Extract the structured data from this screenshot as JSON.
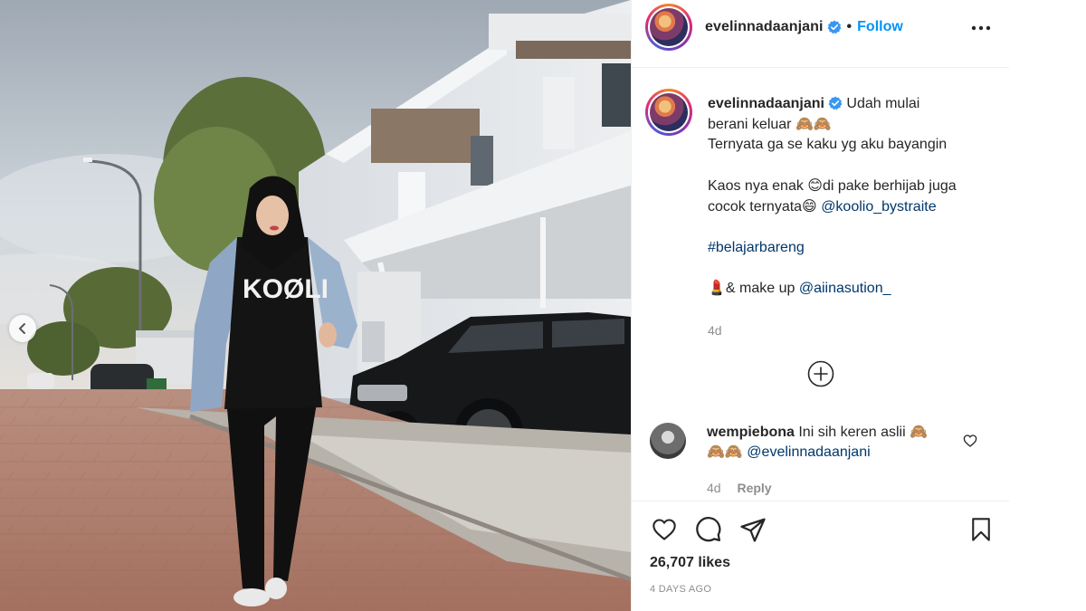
{
  "post": {
    "username": "evelinnadaanjani",
    "follow_label": "Follow",
    "separator": "•",
    "caption_lines": [
      "Udah mulai",
      "berani keluar 🙈🙈",
      "Ternyata ga se kaku yg aku bayangin",
      "",
      "Kaos nya enak 😊di pake berhijab juga",
      "cocok ternyata😄"
    ],
    "caption_mention": "@koolio_bystraite",
    "caption_hashtag": "#belajarbareng",
    "makeup_prefix": "💄& make up",
    "makeup_mention": "@aiinasution_",
    "caption_time": "4d",
    "likes": "26,707 likes",
    "posted": "4 DAYS AGO",
    "shirt_text": "KOØLI"
  },
  "comment": {
    "username": "wempiebona",
    "text": "Ini sih keren aslii 🙈",
    "line2_emoji": "🙈🙈",
    "mention": "@evelinnadaanjani",
    "time": "4d",
    "reply_label": "Reply"
  },
  "icons": {
    "verified": "verified-badge-icon",
    "more": "more-options-icon",
    "load_more": "plus-circle-icon",
    "like": "heart-icon",
    "comment": "comment-icon",
    "share": "share-icon",
    "save": "bookmark-icon",
    "prev": "chevron-left-icon"
  },
  "colors": {
    "accent": "#0095f6",
    "link": "#00376b",
    "muted": "#8e8e8e",
    "verified": "#3897f0"
  }
}
